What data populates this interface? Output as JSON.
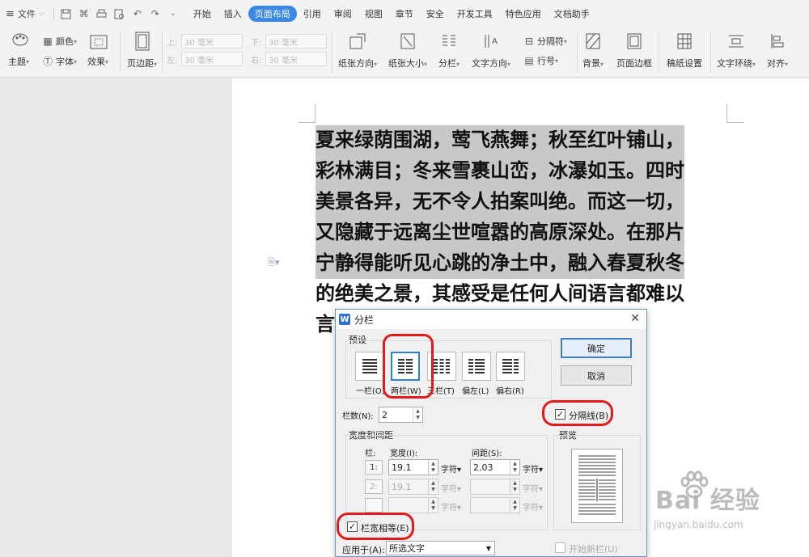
{
  "menubar": {
    "file_label": "文件",
    "tabs": [
      "开始",
      "插入",
      "页面布局",
      "引用",
      "审阅",
      "视图",
      "章节",
      "安全",
      "开发工具",
      "特色应用",
      "文档助手"
    ],
    "active_tab": "页面布局"
  },
  "ribbon": {
    "theme": "主题",
    "color": "颜色",
    "font": "字体",
    "effect": "效果",
    "margins": "页边距",
    "top_label": "上:",
    "bottom_label": "下:",
    "left_label": "左:",
    "right_label": "右:",
    "margin_value": "30 毫米",
    "orientation": "纸张方向",
    "size": "纸张大小",
    "columns": "分栏",
    "text_direction": "文字方向",
    "separator": "分隔符",
    "line_numbers": "行号",
    "background": "背景",
    "page_border": "页面边框",
    "draft_paper": "稿纸设置",
    "wrap": "文字环绕",
    "align": "对齐"
  },
  "document": {
    "lines": [
      "夏来绿荫围湖，莺飞燕舞；秋至红叶铺山，",
      "彩林满目；冬来雪裹山峦，冰瀑如玉。四时",
      "美景各异，无不令人拍案叫绝。而这一切，",
      "又隐藏于远离尘世喧嚣的高原深处。在那片",
      "宁静得能听见心跳的净土中，融入春夏秋冬",
      "的绝美之景，其感受是任何人间语言都难以",
      "言"
    ]
  },
  "dialog": {
    "title": "分栏",
    "presets_label": "预设",
    "presets": [
      "一栏(O)",
      "两栏(W)",
      "三栏(T)",
      "偏左(L)",
      "偏右(R)"
    ],
    "selected_preset": "两栏(W)",
    "ok": "确定",
    "cancel": "取消",
    "columns_label": "栏数(N):",
    "columns_value": "2",
    "separator_line": "分隔线(B)",
    "separator_checked": true,
    "width_spacing_label": "宽度和间距",
    "preview_label": "预览",
    "col_header": "栏:",
    "width_header": "宽度(I):",
    "spacing_header": "间距(S):",
    "rows": [
      {
        "num": "1:",
        "width": "19.1",
        "width_unit": "字符",
        "spacing": "2.03",
        "spacing_unit": "字符"
      },
      {
        "num": "2:",
        "width": "19.1",
        "width_unit": "字符",
        "spacing": "",
        "spacing_unit": "字符"
      },
      {
        "num": "",
        "width": "",
        "width_unit": "字符",
        "spacing": "",
        "spacing_unit": "字符"
      }
    ],
    "equal_width": "栏宽相等(E)",
    "equal_checked": true,
    "apply_to_label": "应用于(A):",
    "apply_to_value": "所选文字",
    "new_column": "开始新栏(U)"
  },
  "watermark": {
    "brand": "Bai 经验",
    "url": "jingyan.baidu.com"
  }
}
